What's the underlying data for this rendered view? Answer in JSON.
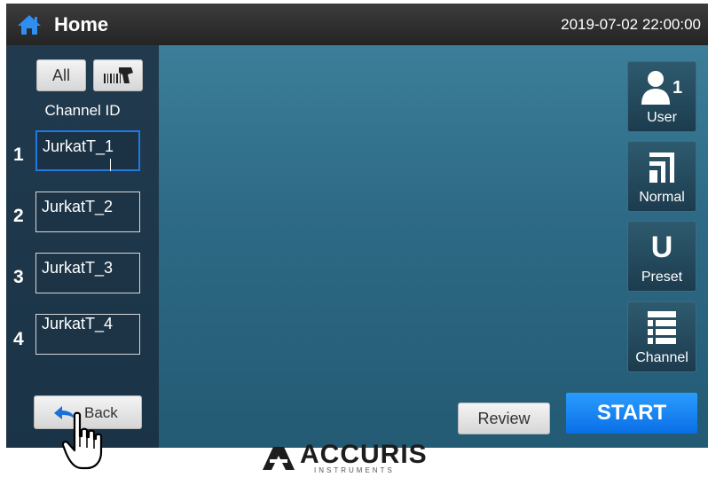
{
  "titlebar": {
    "title": "Home",
    "datetime": "2019-07-02  22:00:00",
    "icon": "home-icon"
  },
  "sidebar": {
    "all_label": "All",
    "barcode_icon": "barcode-scanner-icon",
    "channel_id_label": "Channel ID",
    "channels": [
      {
        "number": "1",
        "value": "JurkatT_1",
        "active": true
      },
      {
        "number": "2",
        "value": "JurkatT_2",
        "active": false
      },
      {
        "number": "3",
        "value": "JurkatT_3",
        "active": false
      },
      {
        "number": "4",
        "value": "JurkatT_4",
        "active": false
      }
    ],
    "back_label": "Back"
  },
  "right_panel": {
    "user": {
      "label": "User",
      "count": "1",
      "icon": "user-icon"
    },
    "normal": {
      "label": "Normal",
      "icon": "normal-mode-icon"
    },
    "preset": {
      "label": "Preset",
      "glyph": "U",
      "icon": "preset-icon"
    },
    "channel": {
      "label": "Channel",
      "icon": "channel-list-icon"
    }
  },
  "actions": {
    "review_label": "Review",
    "start_label": "START"
  },
  "colors": {
    "start_blue": "#1a85f5",
    "active_input_border": "#1f7ae0"
  },
  "logo": {
    "text": "ACCURIS",
    "subtext": "INSTRUMENTS"
  }
}
